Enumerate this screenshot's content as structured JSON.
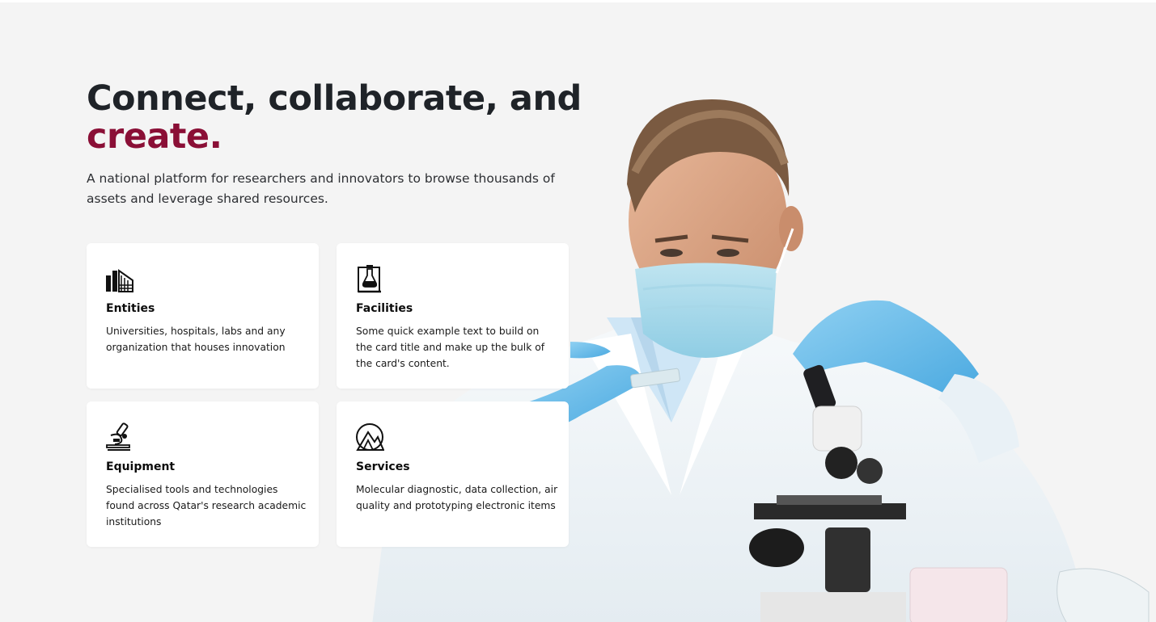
{
  "hero": {
    "headline_main": "Connect, collaborate, and",
    "headline_accent": "create.",
    "subtitle": "A national platform for researchers and innovators to browse thousands of assets and leverage shared resources.",
    "accent_color": "#8a0f36",
    "background_color": "#f4f4f4",
    "image_icon": "scientist-with-microscope-photo"
  },
  "cards": [
    {
      "icon": "buildings-icon",
      "title": "Entities",
      "text": "Universities, hospitals, labs and any organization that houses innovation"
    },
    {
      "icon": "laboratory-flask-icon",
      "title": "Facilities",
      "text": "Some quick example text to build on the card title and make up the bulk of the card's content."
    },
    {
      "icon": "microscope-icon",
      "title": "Equipment",
      "text": "Specialised tools and technologies found across Qatar's research academic institutions"
    },
    {
      "icon": "mountain-circle-icon",
      "title": "Services",
      "text": "Molecular diagnostic, data collection, air quality and prototyping electronic items"
    }
  ]
}
